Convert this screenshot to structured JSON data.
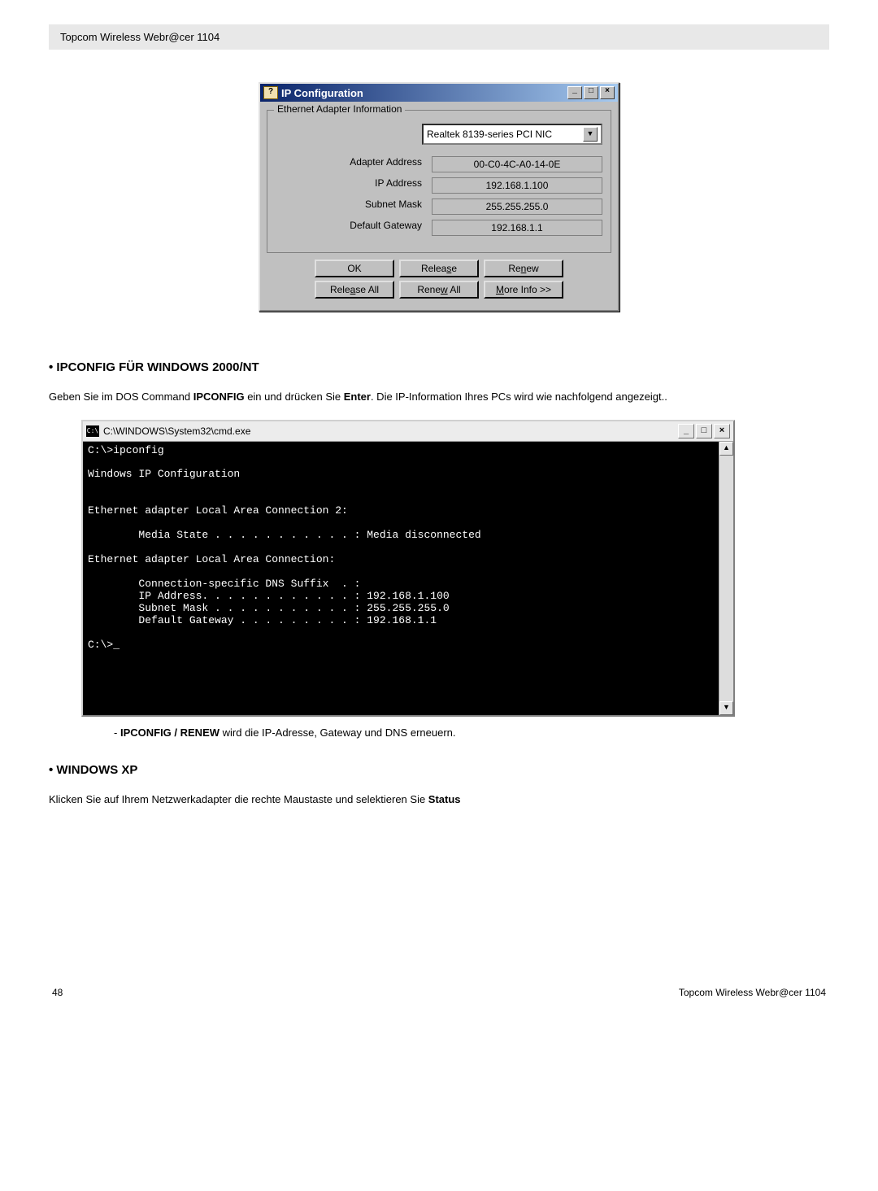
{
  "header": {
    "doc_title": "Topcom Wireless Webr@cer 1104"
  },
  "ipconfig_dialog": {
    "window_title": "IP Configuration",
    "fieldset_label": "Ethernet  Adapter Information",
    "adapter_selected": "Realtek 8139-series PCI NIC",
    "rows": {
      "adapter_address_label": "Adapter Address",
      "adapter_address_value": "00-C0-4C-A0-14-0E",
      "ip_address_label": "IP Address",
      "ip_address_value": "192.168.1.100",
      "subnet_mask_label": "Subnet Mask",
      "subnet_mask_value": "255.255.255.0",
      "default_gateway_label": "Default Gateway",
      "default_gateway_value": "192.168.1.1"
    },
    "buttons": {
      "ok": "OK",
      "release": "Release",
      "renew": "Renew",
      "release_all": "Release All",
      "renew_all": "Renew All",
      "more_info": "More Info >>"
    }
  },
  "section1": {
    "heading": "• IPCONFIG FÜR WINDOWS 2000/NT",
    "para_pre": "Geben Sie im DOS Command ",
    "para_bold1": "IPCONFIG",
    "para_mid": " ein und drücken Sie ",
    "para_bold2": "Enter",
    "para_post": ". Die IP-Information Ihres PCs wird wie nachfolgend angezeigt.."
  },
  "cmd_window": {
    "title": "C:\\WINDOWS\\System32\\cmd.exe",
    "content": "C:\\>ipconfig\n\nWindows IP Configuration\n\n\nEthernet adapter Local Area Connection 2:\n\n        Media State . . . . . . . . . . . : Media disconnected\n\nEthernet adapter Local Area Connection:\n\n        Connection-specific DNS Suffix  . :\n        IP Address. . . . . . . . . . . . : 192.168.1.100\n        Subnet Mask . . . . . . . . . . . : 255.255.255.0\n        Default Gateway . . . . . . . . . : 192.168.1.1\n\nC:\\>_\n\n\n\n\n\n"
  },
  "note": {
    "prefix": "- ",
    "bold": "IPCONFIG / RENEW",
    "rest": " wird die IP-Adresse, Gateway und DNS erneuern."
  },
  "section2": {
    "heading": "• WINDOWS XP",
    "para_pre": "Klicken Sie auf Ihrem Netzwerkadapter die rechte Maustaste und selektieren Sie ",
    "para_bold": "Status"
  },
  "footer": {
    "page": "48",
    "doc_title": "Topcom Wireless Webr@cer 1104"
  }
}
